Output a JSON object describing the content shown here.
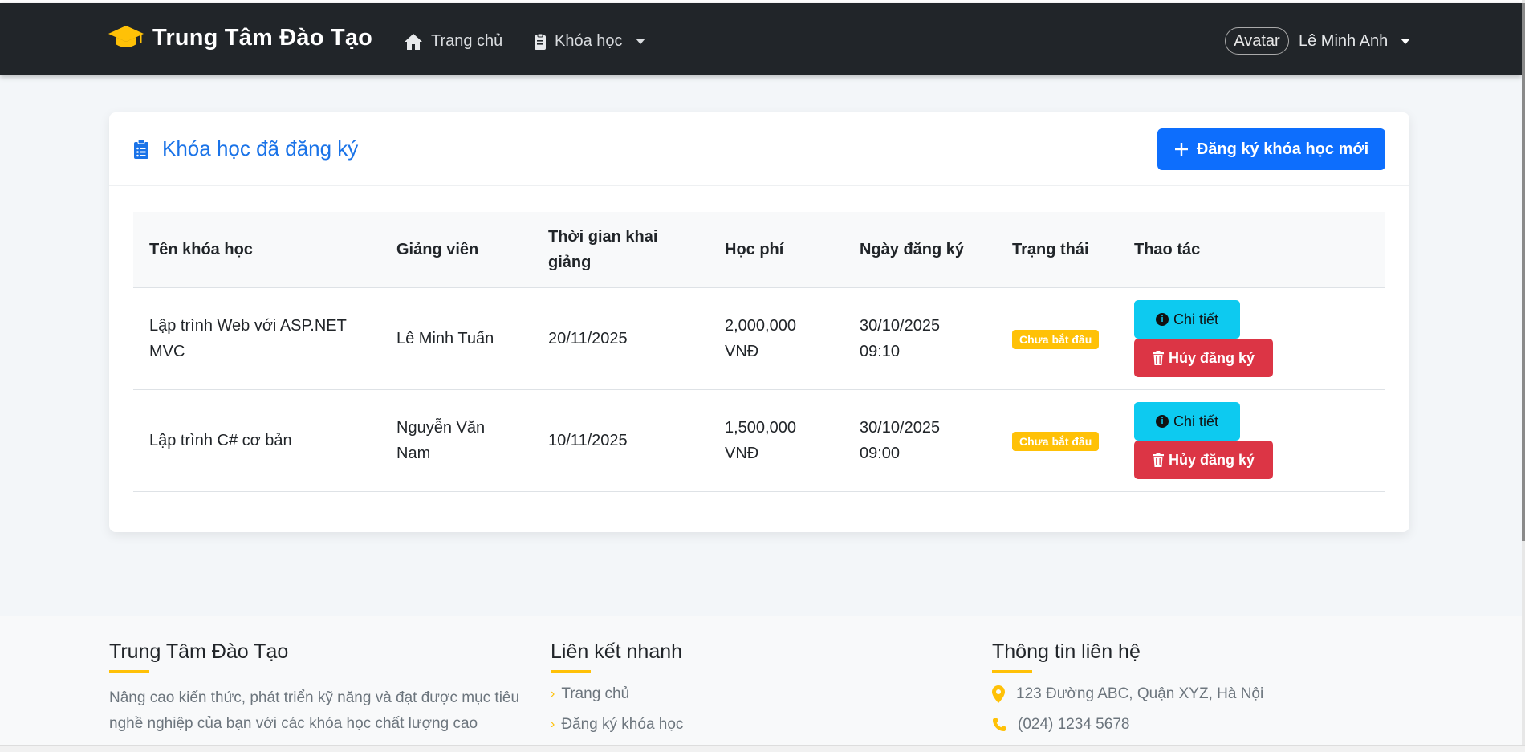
{
  "navbar": {
    "brand": "Trung Tâm Đào Tạo",
    "links": [
      {
        "label": "Trang chủ",
        "icon": "home-icon"
      },
      {
        "label": "Khóa học",
        "icon": "clipboard-icon"
      }
    ],
    "user": {
      "avatar_alt": "Avatar",
      "name": "Lê Minh Anh"
    }
  },
  "card": {
    "title": "Khóa học đã đăng ký",
    "new_button": "Đăng ký khóa học mới",
    "table": {
      "headers": [
        "Tên khóa học",
        "Giảng viên",
        "Thời gian khai giảng",
        "Học phí",
        "Ngày đăng ký",
        "Trạng thái",
        "Thao tác"
      ],
      "rows": [
        {
          "course": "Lập trình Web với ASP.NET MVC",
          "teacher": "Lê Minh Tuấn",
          "start": "20/11/2025",
          "fee": "2,000,000 VNĐ",
          "registered": "30/10/2025 09:10",
          "status": "Chưa bắt đầu",
          "detail": "Chi tiết",
          "cancel": "Hủy đăng ký"
        },
        {
          "course": "Lập trình C# cơ bản",
          "teacher": "Nguyễn Văn Nam",
          "start": "10/11/2025",
          "fee": "1,500,000 VNĐ",
          "registered": "30/10/2025 09:00",
          "status": "Chưa bắt đầu",
          "detail": "Chi tiết",
          "cancel": "Hủy đăng ký"
        }
      ]
    }
  },
  "footer": {
    "about": {
      "title": "Trung Tâm Đào Tạo",
      "text": "Nâng cao kiến thức, phát triển kỹ năng và đạt được mục tiêu nghề nghiệp của bạn với các khóa học chất lượng cao"
    },
    "links": {
      "title": "Liên kết nhanh",
      "items": [
        "Trang chủ",
        "Đăng ký khóa học"
      ]
    },
    "contact": {
      "title": "Thông tin liên hệ",
      "address": "123 Đường ABC, Quận XYZ, Hà Nội",
      "phone": "(024) 1234 5678"
    }
  },
  "colors": {
    "navbar": "#212529",
    "primary": "#0d6efd",
    "info": "#0dcaf0",
    "danger": "#dc3545",
    "warning": "#ffc107"
  }
}
